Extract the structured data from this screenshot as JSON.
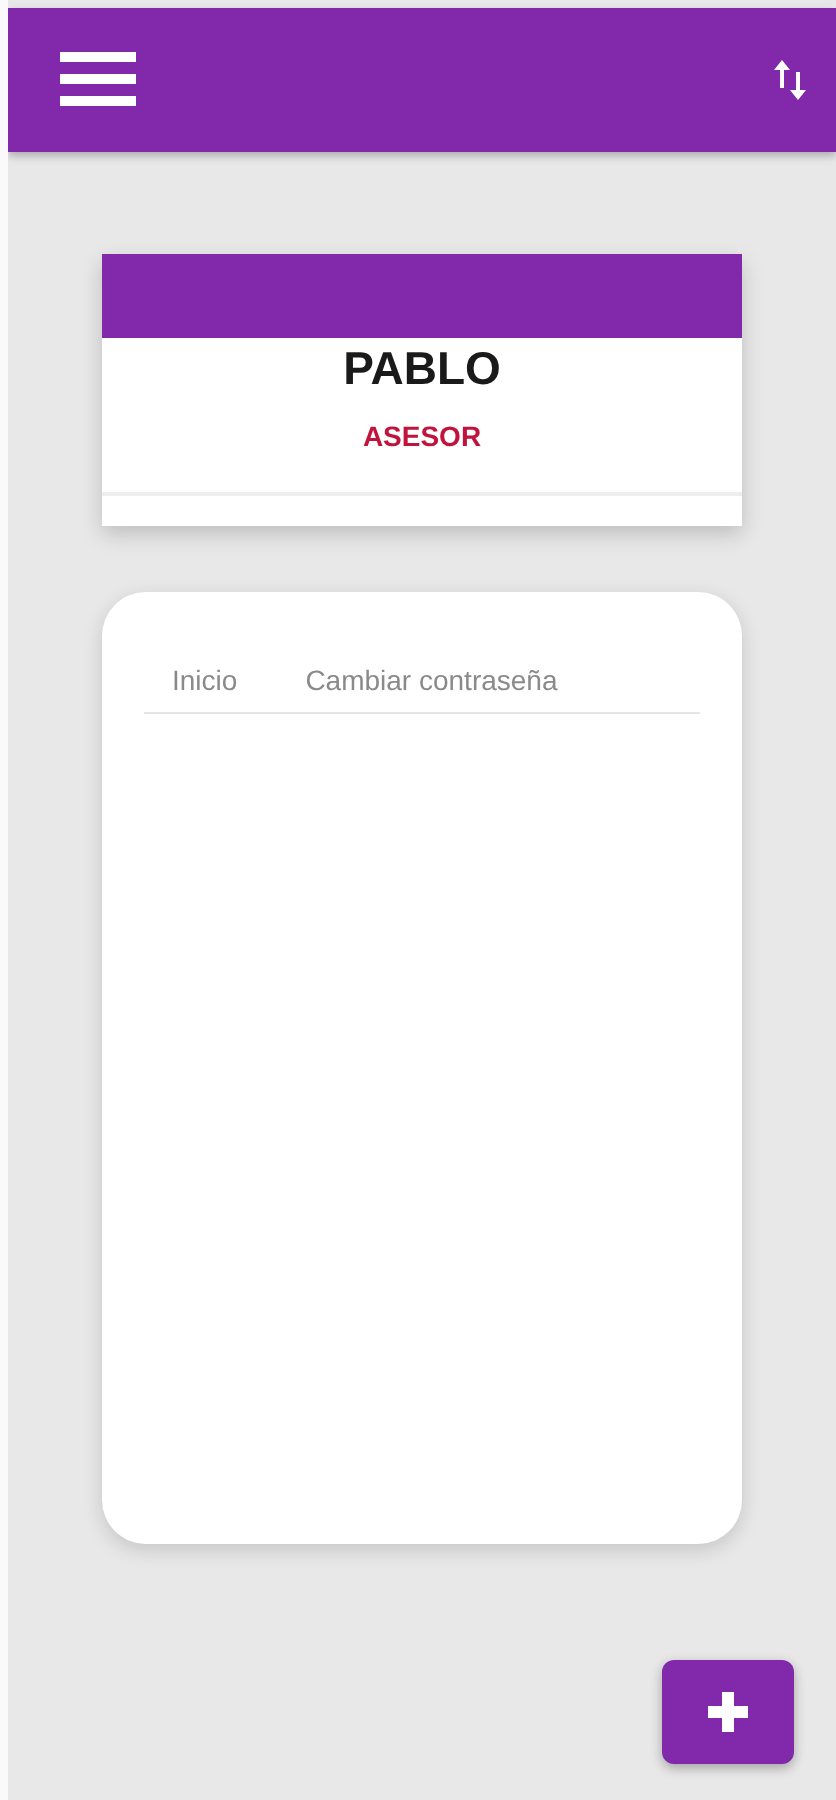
{
  "profile": {
    "name": "PABLO",
    "role": "ASESOR"
  },
  "tabs": [
    {
      "label": "Inicio"
    },
    {
      "label": "Cambiar contraseña"
    }
  ]
}
